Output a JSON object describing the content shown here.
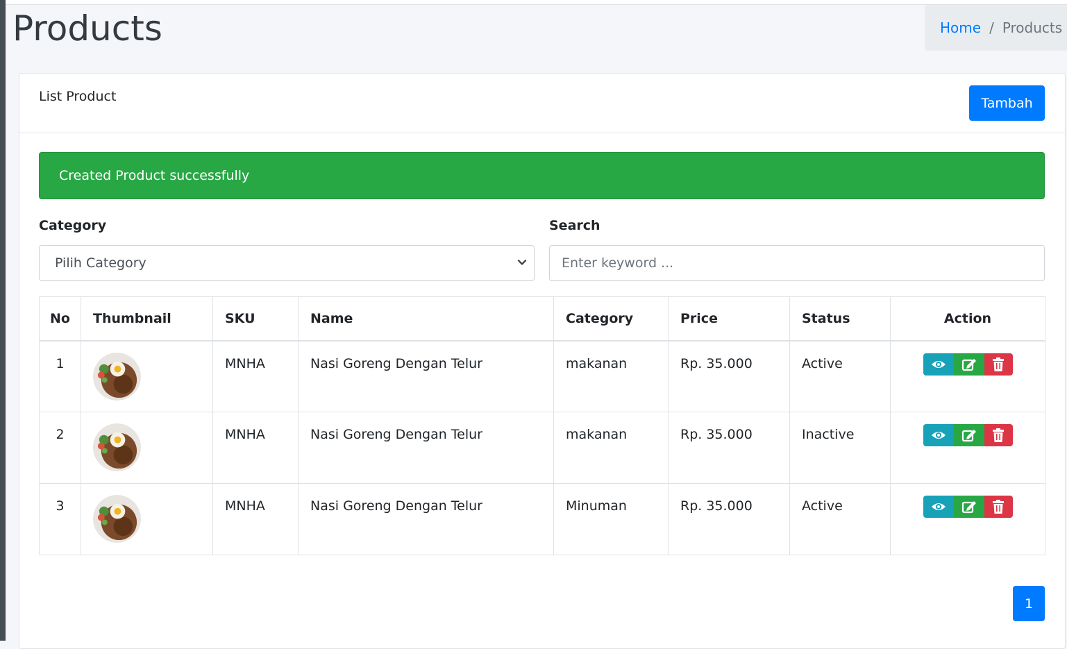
{
  "page": {
    "title": "Products"
  },
  "breadcrumb": {
    "home": "Home",
    "separator": "/",
    "current": "Products"
  },
  "card": {
    "title": "List Product",
    "add_button": "Tambah"
  },
  "alert": {
    "message": "Created Product successfully"
  },
  "filters": {
    "category_label": "Category",
    "category_selected": "Pilih Category",
    "search_label": "Search",
    "search_placeholder": "Enter keyword ..."
  },
  "table": {
    "headers": [
      "No",
      "Thumbnail",
      "SKU",
      "Name",
      "Category",
      "Price",
      "Status",
      "Action"
    ],
    "rows": [
      {
        "no": "1",
        "sku": "MNHA",
        "name": "Nasi Goreng Dengan Telur",
        "category": "makanan",
        "price": "Rp. 35.000",
        "status": "Active"
      },
      {
        "no": "2",
        "sku": "MNHA",
        "name": "Nasi Goreng Dengan Telur",
        "category": "makanan",
        "price": "Rp. 35.000",
        "status": "Inactive"
      },
      {
        "no": "3",
        "sku": "MNHA",
        "name": "Nasi Goreng Dengan Telur",
        "category": "Minuman",
        "price": "Rp. 35.000",
        "status": "Active"
      }
    ]
  },
  "pagination": {
    "current": "1"
  },
  "colors": {
    "primary": "#007bff",
    "success": "#28a745",
    "info": "#17a2b8",
    "danger": "#dc3545"
  },
  "icons": {
    "view": "eye-icon",
    "edit": "edit-icon",
    "delete": "trash-icon",
    "select": "chevron-down-icon"
  }
}
